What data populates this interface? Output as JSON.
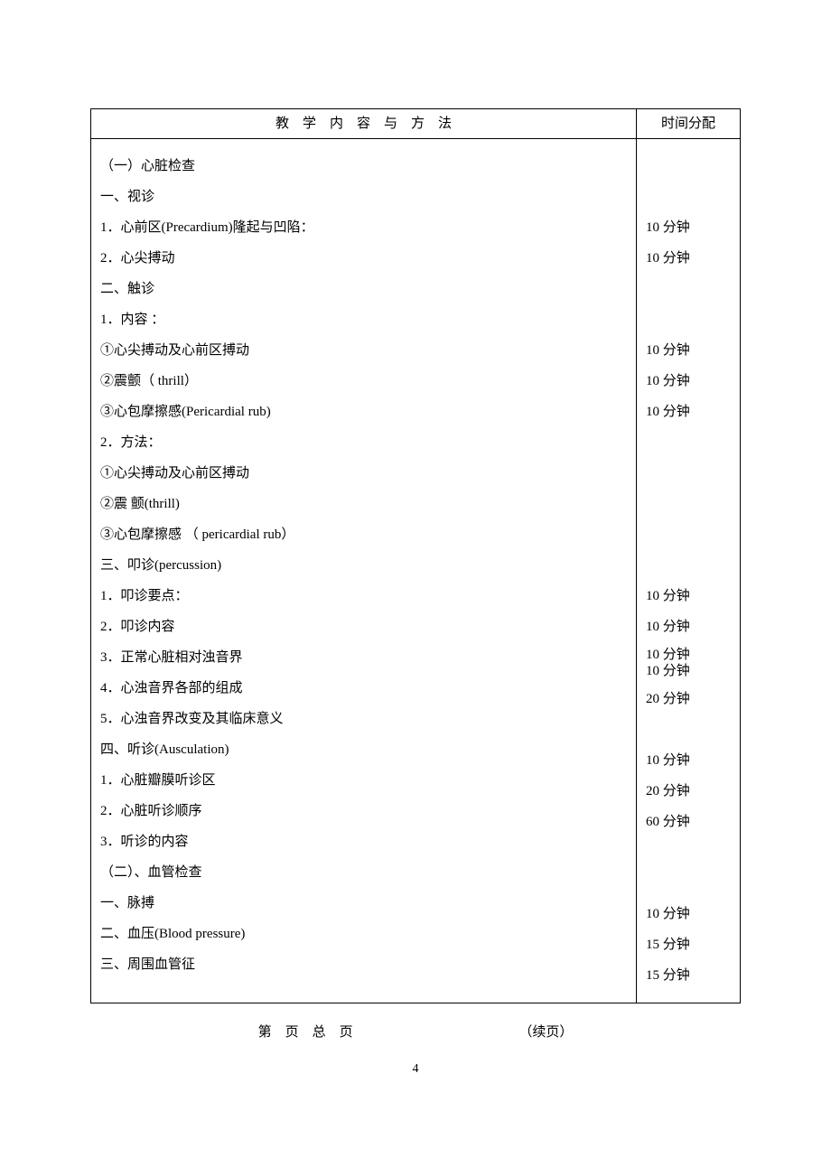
{
  "header": {
    "col1": "教　学　内　容　与　方　法",
    "col2": "时间分配"
  },
  "rows": [
    {
      "text": "（一）心脏检查",
      "time": ""
    },
    {
      "text": "一、视诊",
      "time": ""
    },
    {
      "text": "1．心前区(Precardium)隆起与凹陷：",
      "time": "10 分钟"
    },
    {
      "text": "2．心尖搏动",
      "time": "10 分钟"
    },
    {
      "text": "二、触诊",
      "time": ""
    },
    {
      "text": "1．内容 ：",
      "time": ""
    },
    {
      "text": "①心尖搏动及心前区搏动",
      "time": "10 分钟"
    },
    {
      "text": "②震颤（ thrill）",
      "time": "10 分钟"
    },
    {
      "text": "③心包摩擦感(Pericardial rub)",
      "time": "10 分钟"
    },
    {
      "text": "2．方法：",
      "time": ""
    },
    {
      "text": "①心尖搏动及心前区搏动",
      "time": ""
    },
    {
      "text": "②震 颤(thrill)",
      "time": ""
    },
    {
      "text": "③心包摩擦感 （ pericardial rub）",
      "time": ""
    },
    {
      "text": "三、叩诊(percussion)",
      "time": ""
    },
    {
      "text": "1．叩诊要点：",
      "time": "10 分钟"
    },
    {
      "text": "2．叩诊内容",
      "time": "10 分钟"
    },
    {
      "text": "3．正常心脏相对浊音界",
      "time": "10 分钟\n10 分钟"
    },
    {
      "text": "4．心浊音界各部的组成",
      "time": "20 分钟"
    },
    {
      "text": "5．心浊音界改变及其临床意义",
      "time": ""
    },
    {
      "text": "四、听诊(Ausculation)",
      "time": "10 分钟"
    },
    {
      "text": "1．心脏瓣膜听诊区",
      "time": "20 分钟"
    },
    {
      "text": "2．心脏听诊顺序",
      "time": "60 分钟"
    },
    {
      "text": "3．听诊的内容",
      "time": ""
    },
    {
      "text": "（二）、血管检查",
      "time": ""
    },
    {
      "text": "一、脉搏",
      "time": "10 分钟"
    },
    {
      "text": "二、血压(Blood pressure)",
      "time": "15 分钟"
    },
    {
      "text": "三、周围血管征",
      "time": "15 分钟"
    }
  ],
  "footer": {
    "left": "第　页　总　页",
    "right": "（续页）"
  },
  "page_number": "4"
}
